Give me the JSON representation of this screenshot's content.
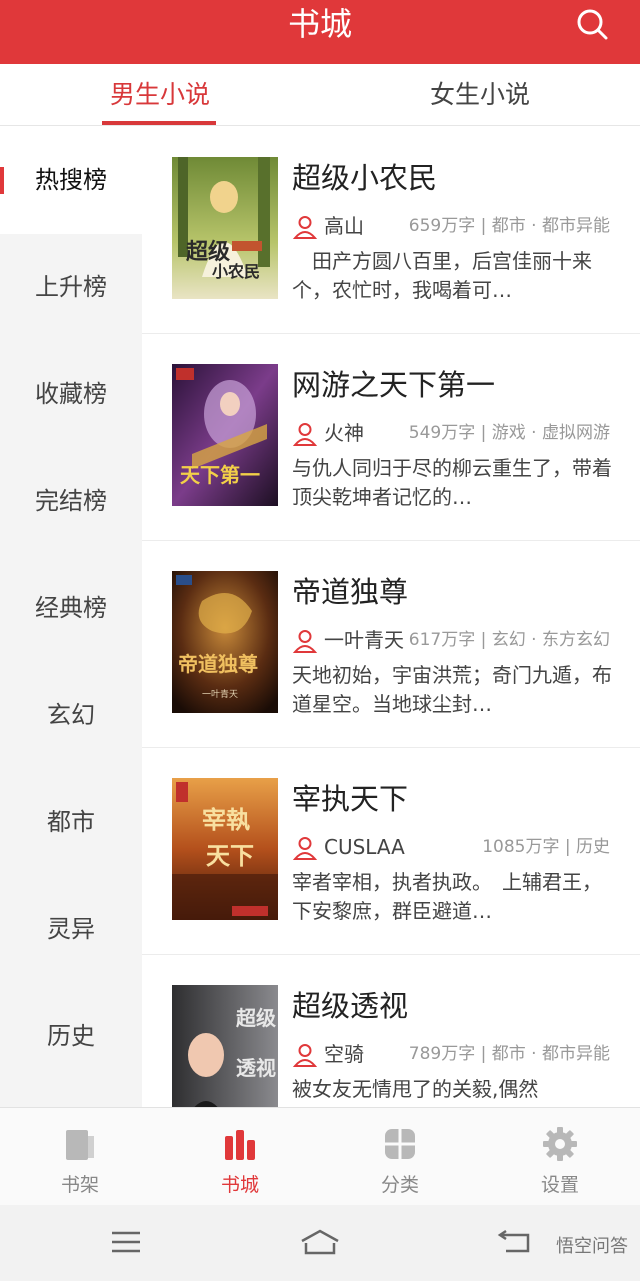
{
  "header": {
    "title": "书城",
    "search_icon": "search-icon"
  },
  "tabs": [
    {
      "label": "男生小说",
      "active": true
    },
    {
      "label": "女生小说",
      "active": false
    }
  ],
  "sidebar": {
    "items": [
      {
        "label": "热搜榜",
        "active": true
      },
      {
        "label": "上升榜"
      },
      {
        "label": "收藏榜"
      },
      {
        "label": "完结榜"
      },
      {
        "label": "经典榜"
      },
      {
        "label": "玄幻"
      },
      {
        "label": "都市"
      },
      {
        "label": "灵异"
      },
      {
        "label": "历史"
      }
    ]
  },
  "books": [
    {
      "title": "超级小农民",
      "author": "高山",
      "info": "659万字 | 都市 · 都市异能",
      "desc": "　田产方圆八百里，后宫佳丽十来个，农忙时，我喝着可…",
      "cover_text": "超级小农民"
    },
    {
      "title": "网游之天下第一",
      "author": "火神",
      "info": "549万字 | 游戏 · 虚拟网游",
      "desc": "与仇人同归于尽的柳云重生了，带着顶尖乾坤者记忆的…",
      "cover_text": "天下第一"
    },
    {
      "title": "帝道独尊",
      "author": "一叶青天",
      "info": "617万字 | 玄幻 · 东方玄幻",
      "desc": "天地初始，宇宙洪荒；奇门九遁，布道星空。当地球尘封…",
      "cover_text": "帝道独尊"
    },
    {
      "title": "宰执天下",
      "author": "CUSLAA",
      "info": "1085万字 | 历史",
      "desc": "宰者宰相，执者执政。　上辅君王，下安黎庶，群臣避道…",
      "cover_text": "宰执天下"
    },
    {
      "title": "超级透视",
      "author": "空骑",
      "info": "789万字 | 都市 · 都市异能",
      "desc": "被女友无情甩了的关毅,偶然",
      "cover_text": "超级透视"
    }
  ],
  "bottom_nav": [
    {
      "label": "书架",
      "icon": "bookshelf-icon",
      "active": false
    },
    {
      "label": "书城",
      "icon": "bookstore-icon",
      "active": true
    },
    {
      "label": "分类",
      "icon": "category-icon",
      "active": false
    },
    {
      "label": "设置",
      "icon": "settings-icon",
      "active": false
    }
  ],
  "watermark": "悟空问答",
  "colors": {
    "accent": "#e0383a",
    "sidebar_bg": "#f4f4f4"
  }
}
